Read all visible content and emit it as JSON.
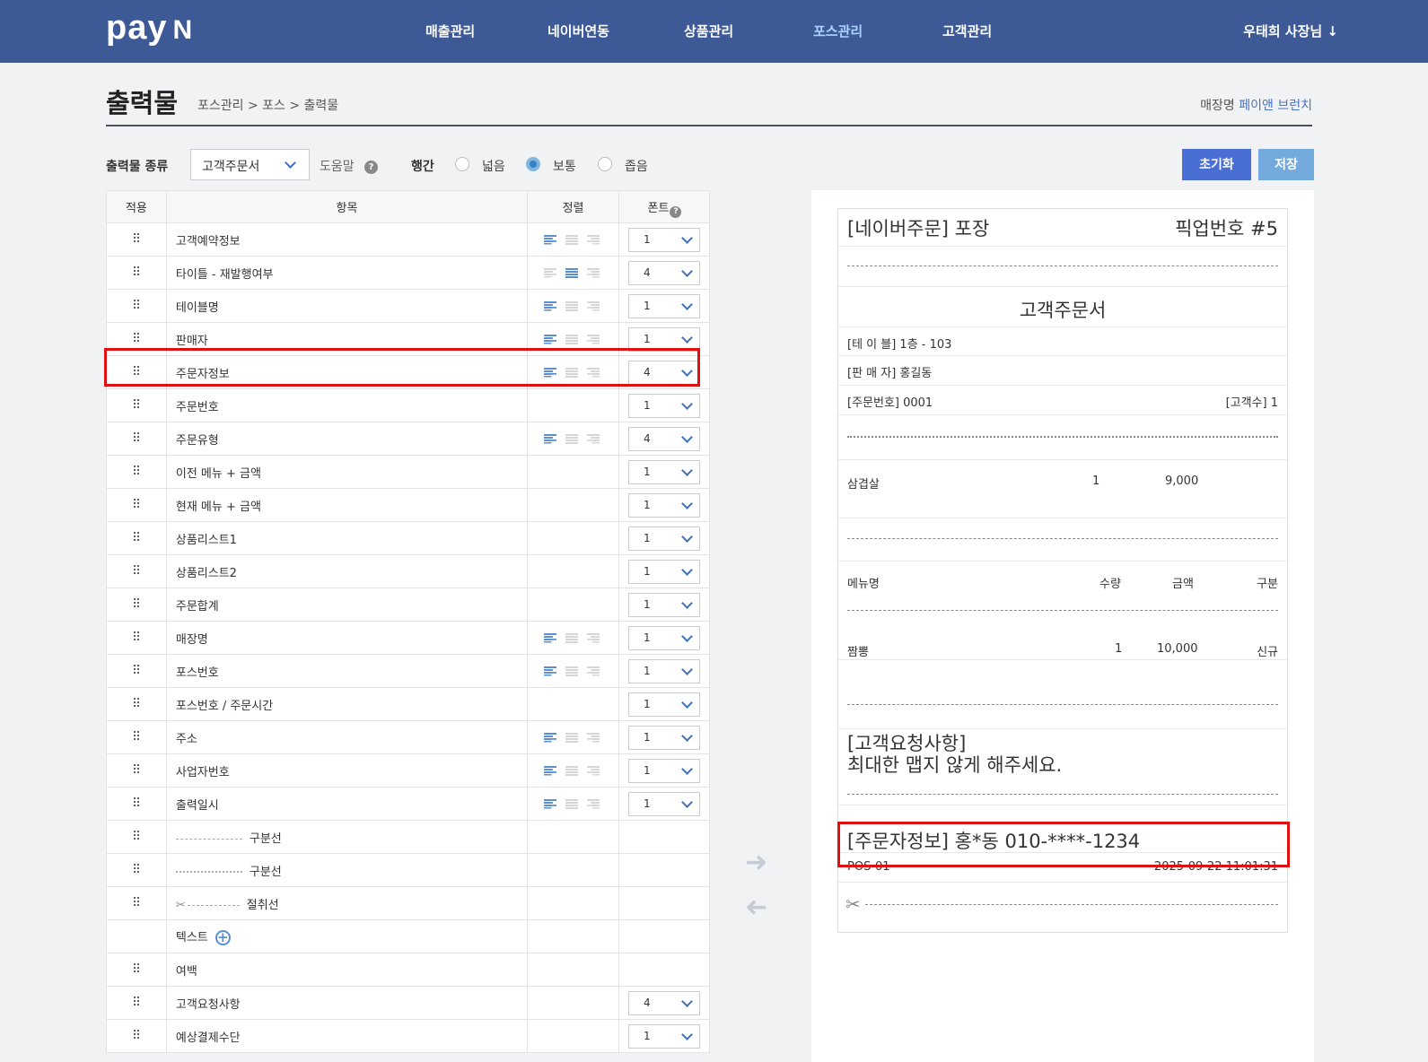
{
  "nav": {
    "logo_main": "pay",
    "logo_n": "N",
    "items": [
      "매출관리",
      "네이버연동",
      "상품관리",
      "포스관리",
      "고객관리"
    ],
    "active": "포스관리",
    "user": "우태희 사장님"
  },
  "header": {
    "title": "출력물",
    "breadcrumb": "포스관리 > 포스 > 출력물",
    "store_label": "매장명",
    "store_name": "페이앤 브런치"
  },
  "controls": {
    "type_label": "출력물 종류",
    "type_value": "고객주문서",
    "help_label": "도움말",
    "help_q": "?",
    "spacing_label": "행간",
    "spacing_options": [
      "넓음",
      "보통",
      "좁음"
    ],
    "spacing_selected": "보통",
    "reset_button": "초기화",
    "save_button": "저장"
  },
  "table": {
    "headers": {
      "apply": "적용",
      "item": "항목",
      "align": "정렬",
      "font": "폰트"
    },
    "rows": [
      {
        "label": "고객예약정보",
        "align": "left",
        "font": "1",
        "grip": true
      },
      {
        "label": "타이틀 - 재발행여부",
        "align": "center",
        "font": "4",
        "grip": true
      },
      {
        "label": "테이블명",
        "align": "left",
        "font": "1",
        "grip": true
      },
      {
        "label": "판매자",
        "align": "left",
        "font": "1",
        "grip": true
      },
      {
        "label": "주문자정보",
        "align": "left",
        "font": "4",
        "grip": true
      },
      {
        "label": "주문번호",
        "align": "",
        "font": "1",
        "grip": true
      },
      {
        "label": "주문유형",
        "align": "left",
        "font": "4",
        "grip": true
      },
      {
        "label": "이전 메뉴 + 금액",
        "align": "",
        "font": "1",
        "grip": true
      },
      {
        "label": "현재 메뉴 + 금액",
        "align": "",
        "font": "1",
        "grip": true
      },
      {
        "label": "상품리스트1",
        "align": "",
        "font": "1",
        "grip": true
      },
      {
        "label": "상품리스트2",
        "align": "",
        "font": "1",
        "grip": true
      },
      {
        "label": "주문합계",
        "align": "",
        "font": "1",
        "grip": true
      },
      {
        "label": "매장명",
        "align": "left",
        "font": "1",
        "grip": true
      },
      {
        "label": "포스번호",
        "align": "left",
        "font": "1",
        "grip": true
      },
      {
        "label": "포스번호 / 주문시간",
        "align": "",
        "font": "1",
        "grip": true
      },
      {
        "label": "주소",
        "align": "left",
        "font": "1",
        "grip": true
      },
      {
        "label": "사업자번호",
        "align": "left",
        "font": "1",
        "grip": true
      },
      {
        "label": "출력일시",
        "align": "left",
        "font": "1",
        "grip": true
      },
      {
        "label": "구분선",
        "sample": "dash",
        "grip": true
      },
      {
        "label": "구분선",
        "sample": "dotted",
        "grip": true
      },
      {
        "label": "절취선",
        "sample": "cut",
        "grip": true
      },
      {
        "label": "텍스트",
        "sample": "plus",
        "grip": false
      },
      {
        "label": "여백",
        "grip": true
      },
      {
        "label": "고객요청사항",
        "align": "",
        "font": "4",
        "grip": true
      },
      {
        "label": "예상결제수단",
        "align": "",
        "font": "1",
        "grip": true
      }
    ]
  },
  "receipt": {
    "title_left": "[네이버주문] 포장",
    "title_right": "픽업번호 #5",
    "doc_title": "고객주문서",
    "table_line": "[테 이 블] 1층 - 103",
    "seller_line": "[판 매 자] 홍길동",
    "order_no": "[주문번호] 0001",
    "guest_count": "[고객수] 1",
    "prev_item": {
      "name": "삼겹살",
      "qty": "1",
      "amount": "9,000"
    },
    "list_headers": {
      "menu": "메뉴명",
      "qty": "수량",
      "amount": "금액",
      "type": "구분"
    },
    "cur_item": {
      "name": "짬뽕",
      "qty": "1",
      "amount": "10,000",
      "type": "신규"
    },
    "request_title": "[고객요청사항]",
    "request_text": "최대한 맵지 않게 해주세요.",
    "orderer": "[주문자정보] 홍*동 010-****-1234",
    "pos": "POS-01",
    "printed_at": "2025-09-22 11:01:31"
  },
  "colors": {
    "topbar": "#3d5a96",
    "highlight": "#e01010",
    "accent": "#4a6fd4"
  }
}
